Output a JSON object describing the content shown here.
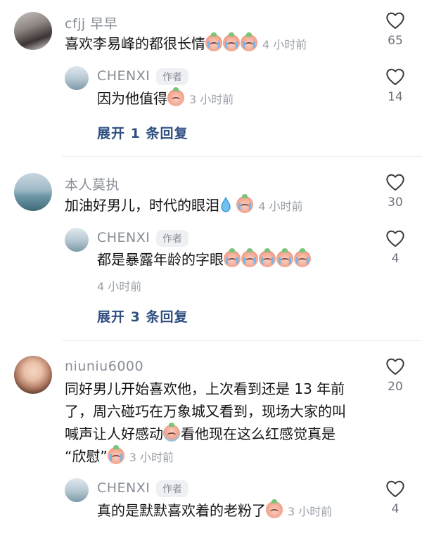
{
  "comments": [
    {
      "username": "cfjj 早早",
      "text": "喜欢李易峰的都很长情",
      "emoji_count": 3,
      "time": "4 小时前",
      "likes": "65",
      "reply": {
        "username": "CHENXI",
        "badge": "作者",
        "text": "因为他值得",
        "time": "3 小时前",
        "likes": "14"
      },
      "expand": "展开 1 条回复"
    },
    {
      "username": "本人莫执",
      "text": "加油好男儿，时代的眼泪",
      "time": "4 小时前",
      "likes": "30",
      "reply": {
        "username": "CHENXI",
        "badge": "作者",
        "text": "都是暴露年龄的字眼",
        "time": "4 小时前",
        "likes": "4"
      },
      "expand": "展开 3 条回复"
    },
    {
      "username": "niuniu6000",
      "line1": "同好男儿开始喜欢他，上次看到还是 13 年前",
      "line2": "了，周六碰巧在万象城又看到，现场大家的叫",
      "line3a": "喊声让人好感动",
      "line3b": "看他现在这么红感觉真是",
      "line4": "“欣慰”",
      "time": "3 小时前",
      "likes": "20",
      "reply": {
        "username": "CHENXI",
        "badge": "作者",
        "text": "真的是默默喜欢着的老粉了",
        "time": "3 小时前",
        "likes": "4"
      }
    }
  ],
  "icons": {
    "like": "heart-outline-icon",
    "emoji": "crying-peach-emoji-icon",
    "drop": "droplet-icon"
  },
  "colors": {
    "link": "#2e4e80",
    "meta": "#9ba0a8",
    "username": "#888d96"
  }
}
